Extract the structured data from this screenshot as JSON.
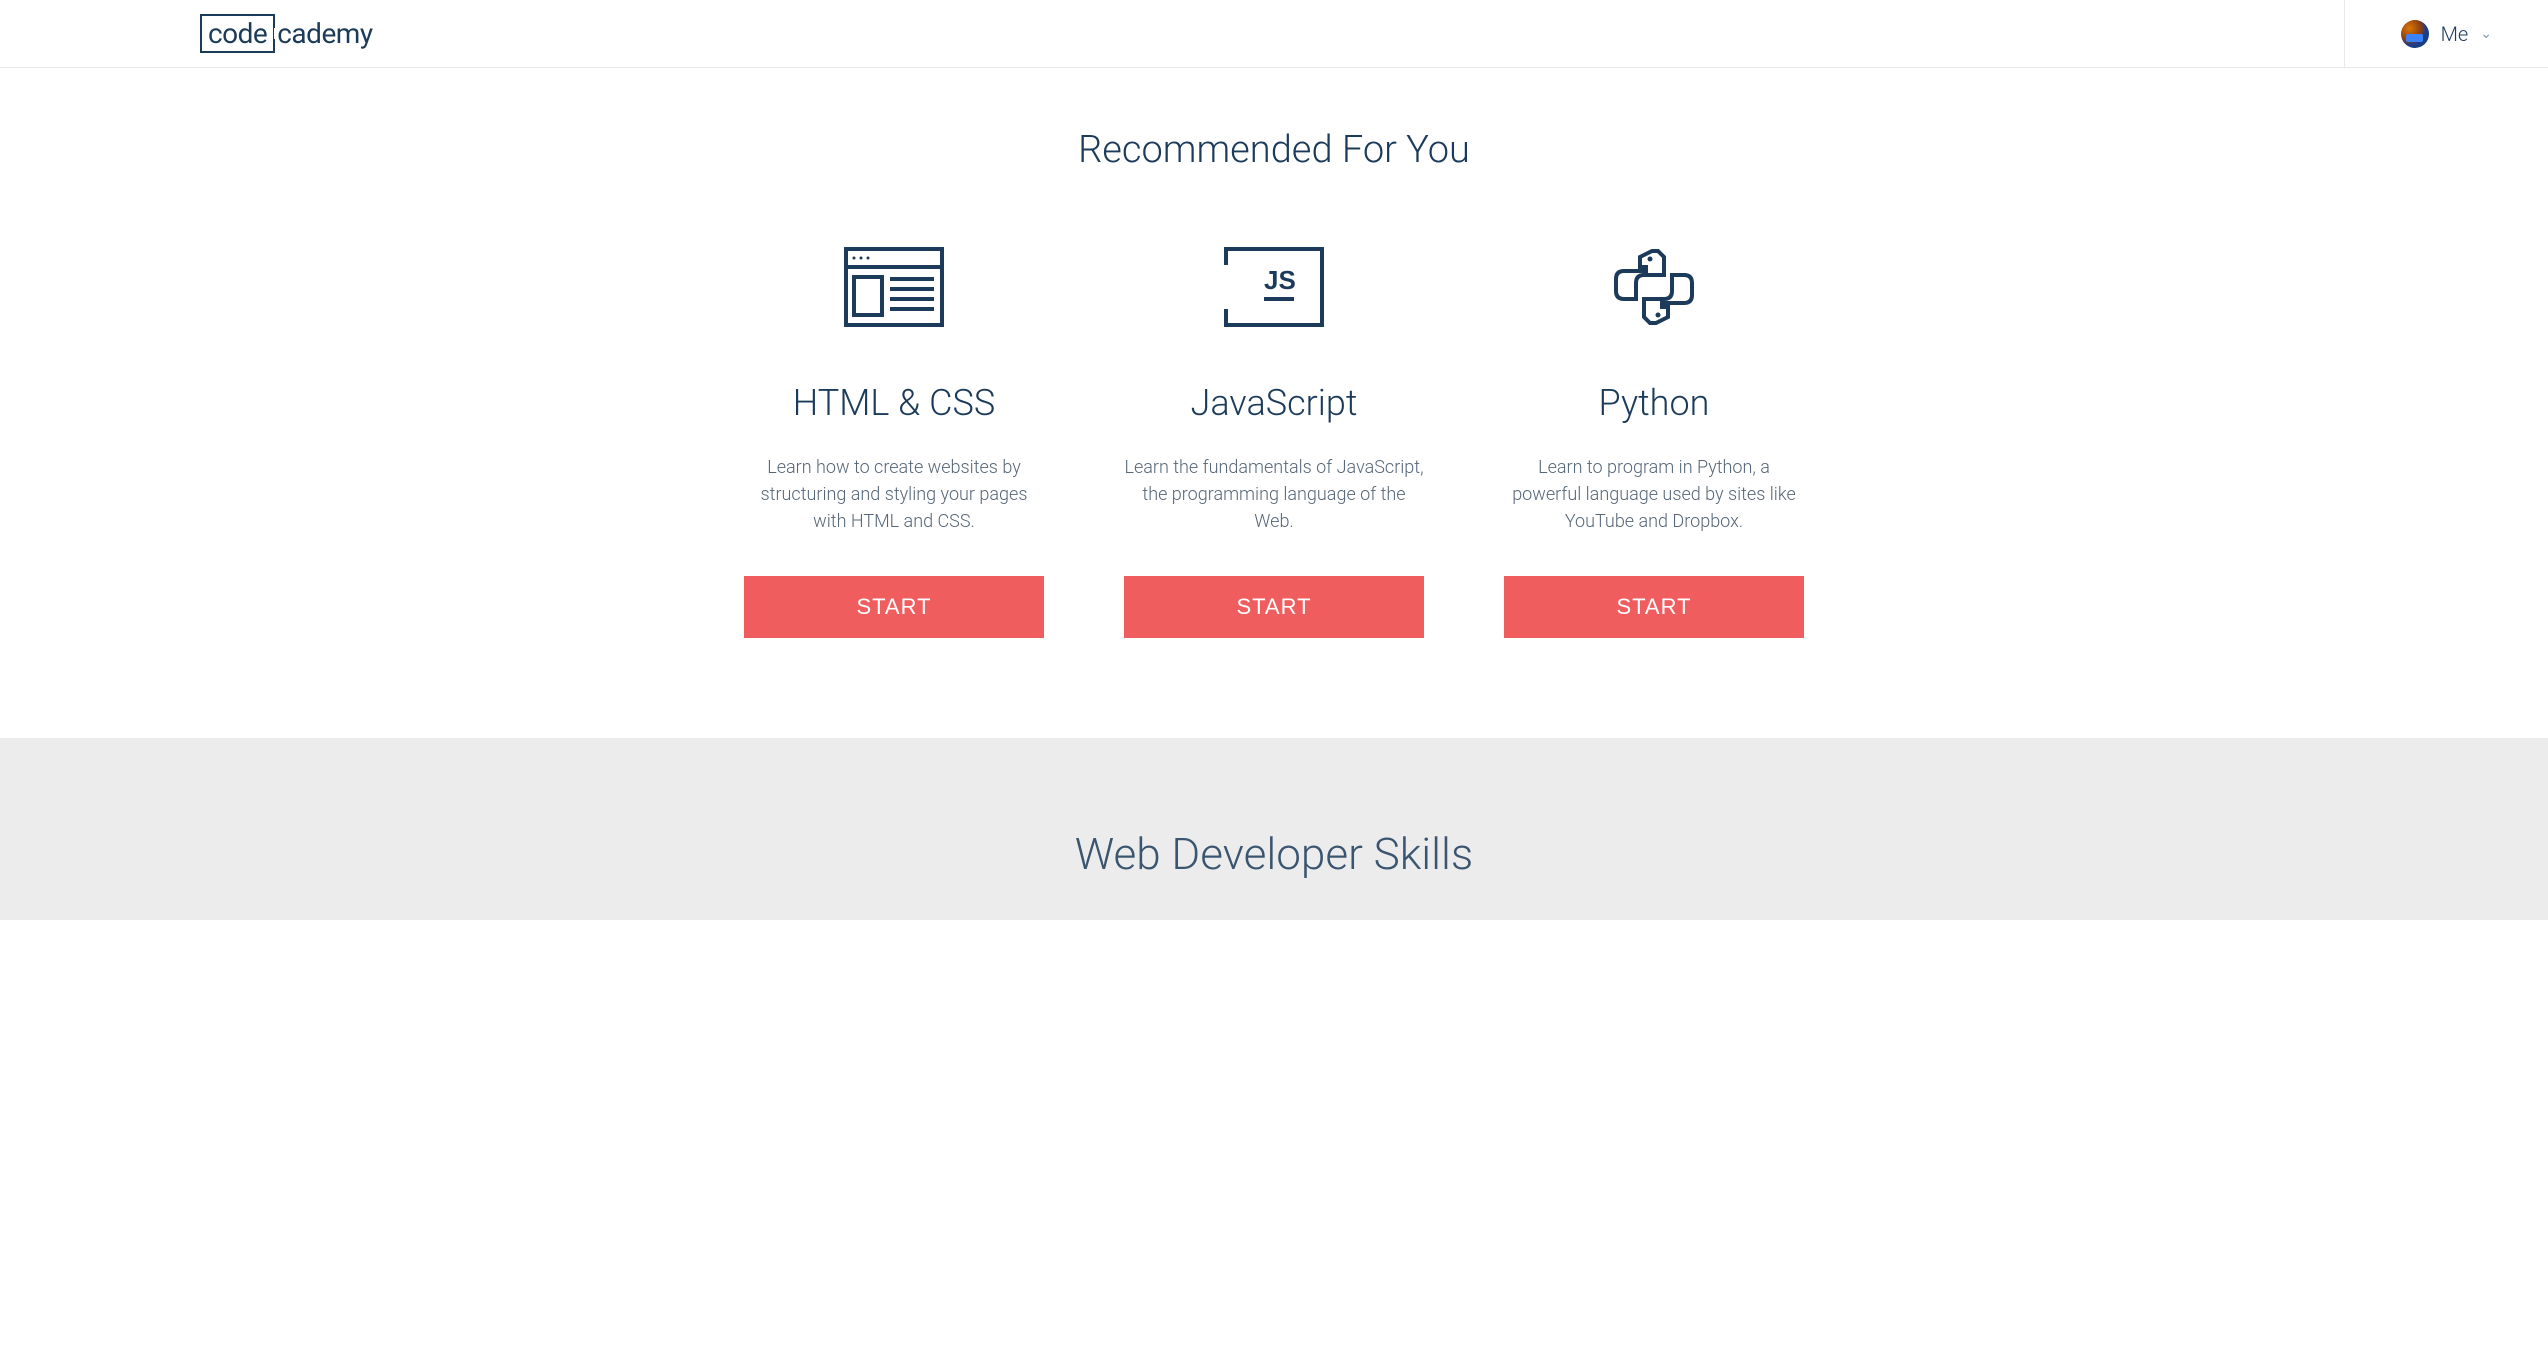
{
  "header": {
    "logo_part1": "code",
    "logo_part2": "cademy",
    "user_label": "Me"
  },
  "main": {
    "section_title": "Recommended For You",
    "cards": [
      {
        "title": "HTML & CSS",
        "description": "Learn how to create websites by structuring and styling your pages with HTML and CSS.",
        "button_label": "START"
      },
      {
        "title": "JavaScript",
        "description": "Learn the fundamentals of JavaScript, the programming language of the Web.",
        "button_label": "START"
      },
      {
        "title": "Python",
        "description": "Learn to program in Python, a powerful language used by sites like YouTube and Dropbox.",
        "button_label": "START"
      }
    ]
  },
  "next_section": {
    "title": "Web Developer Skills"
  }
}
